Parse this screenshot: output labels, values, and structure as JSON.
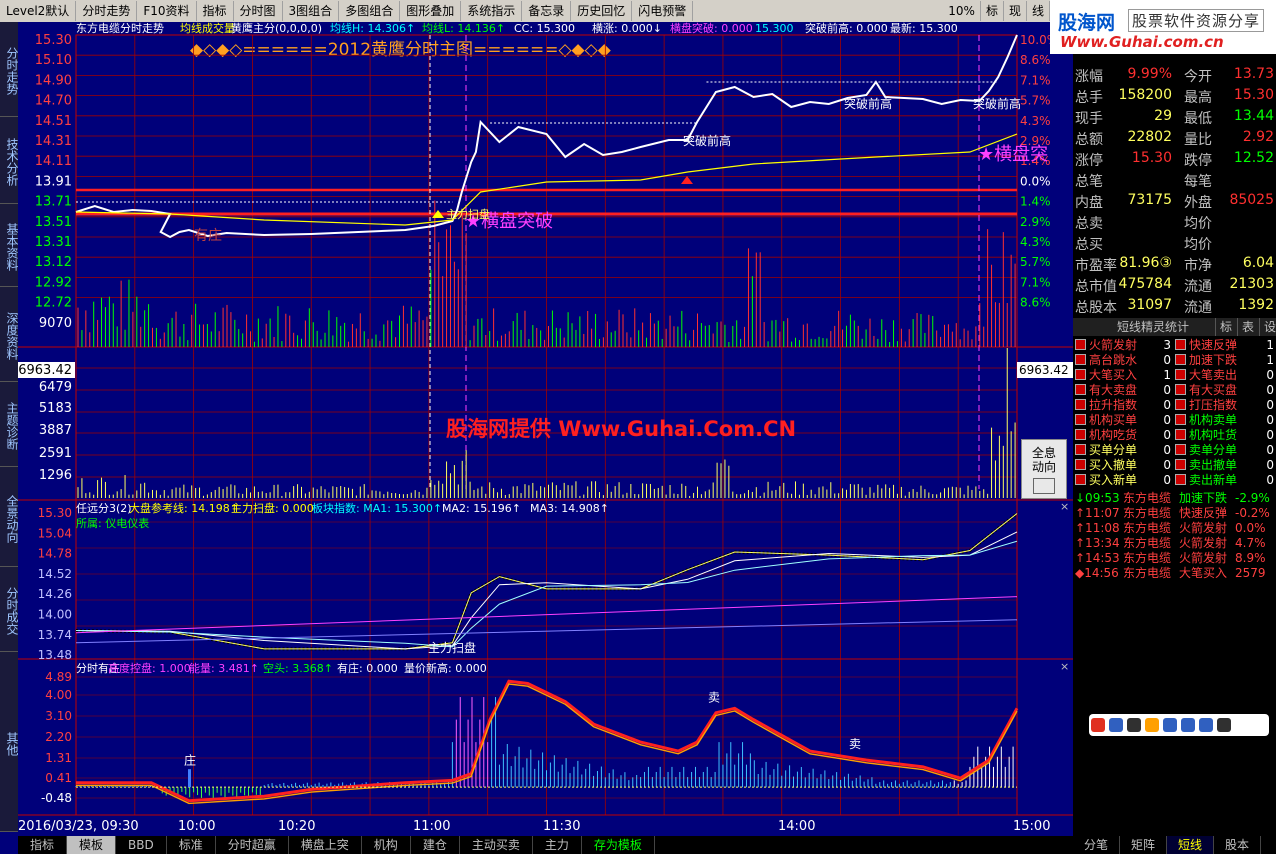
{
  "menubar": {
    "items": [
      "Level2默认",
      "分时走势",
      "F10资料",
      "指标",
      "分时图",
      "3图组合",
      "多图组合",
      "图形叠加",
      "系统指示",
      "备忘录",
      "历史回忆",
      "闪电预警"
    ],
    "right": [
      "10%",
      "标",
      "现",
      "线"
    ]
  },
  "left_tabs": [
    "分时走势",
    "技术分析",
    "基本资料",
    "深度资料",
    "主题诊断",
    "全景动向",
    "分时成交",
    "其他"
  ],
  "main_header": {
    "title": "东方电缆分时走势",
    "items": [
      "均线",
      "成交量",
      "黄鹰主分(0,0,0,0)",
      "均线H: 14.306↑",
      "均线L: 14.136↑",
      "CC: 15.300",
      "横涨: 0.000↓",
      "横盘突破: 0.000",
      "15.300",
      "突破前高: 0.000",
      "最新: 15.300"
    ]
  },
  "banner": "◆◇◆◇======2012黄鹰分时主图======◇◆◇◆",
  "price_axis_left": [
    "15.30",
    "15.10",
    "14.90",
    "14.70",
    "14.51",
    "14.31",
    "14.11",
    "13.91",
    "13.71",
    "13.51",
    "13.31",
    "13.12",
    "12.92",
    "12.72",
    "9070"
  ],
  "pct_axis_right": [
    "10.0%",
    "8.6%",
    "7.1%",
    "5.7%",
    "4.3%",
    "2.9%",
    "1.4%",
    "0.0%",
    "1.4%",
    "2.9%",
    "4.3%",
    "5.7%",
    "7.1%",
    "8.6%"
  ],
  "volume_axis": [
    "6963.42",
    "6479",
    "5183",
    "3887",
    "2591",
    "1296"
  ],
  "volume_right_label": "6963.42",
  "annotations": {
    "tupo1": "突破前高",
    "tupo2": "突破前高",
    "tupo3": "突破前高",
    "hengpan": "横盘突破",
    "hengpan_right": "横盘突",
    "youzhuang": "有庄",
    "zhuli": "主力扫盘",
    "watermark": "股海网提供 Www.Guhai.Com.CN",
    "mai1": "卖",
    "mai2": "卖",
    "zhuang": "庄"
  },
  "panel2": {
    "header": [
      "任远分3(2)",
      "大盘参考线: 14.198↑",
      "主力扫盘: 0.000",
      "板块指数: MA1: 15.300↑",
      "MA2: 15.196↑",
      "MA3: 14.908↑"
    ],
    "sub": "所属: 仪电仪表",
    "axis": [
      "15.30",
      "15.04",
      "14.78",
      "14.52",
      "14.26",
      "14.00",
      "13.74",
      "13.48"
    ]
  },
  "panel3": {
    "header": [
      "分时有庄",
      "高度控盘: 1.000",
      "能量: 3.481↑",
      "空头: 3.368↑",
      "有庄: 0.000",
      "量价新高: 0.000"
    ],
    "axis": [
      "4.89",
      "4.00",
      "3.10",
      "2.20",
      "1.31",
      "0.41",
      "-0.48"
    ]
  },
  "time_axis": [
    "2016/03/23, 09:30",
    "10:00",
    "10:20",
    "11:00",
    "11:30",
    "14:00",
    "15:00"
  ],
  "bottom_tabs": [
    "指标",
    "模板",
    "BBD",
    "标准",
    "分时超赢",
    "横盘上突",
    "机构",
    "建仓",
    "主动买卖",
    "主力",
    "存为模板"
  ],
  "logo": {
    "main": "股海网",
    "sub": "股票软件资源分享",
    "url": "Www.Guhai.com.cn"
  },
  "quote": [
    {
      "l1": "涨幅",
      "v1": "9.99%",
      "l2": "今开",
      "v2": "13.73"
    },
    {
      "l1": "总手",
      "v1": "158200",
      "l2": "最高",
      "v2": "15.30"
    },
    {
      "l1": "现手",
      "v1": "29",
      "l2": "最低",
      "v2": "13.44"
    },
    {
      "l1": "总额",
      "v1": "22802",
      "l2": "量比",
      "v2": "2.92"
    },
    {
      "l1": "涨停",
      "v1": "15.30",
      "l2": "跌停",
      "v2": "12.52"
    },
    {
      "l1": "总笔",
      "v1": "",
      "l2": "每笔",
      "v2": ""
    },
    {
      "l1": "内盘",
      "v1": "73175",
      "l2": "外盘",
      "v2": "85025"
    },
    {
      "l1": "总卖",
      "v1": "",
      "l2": "均价",
      "v2": ""
    },
    {
      "l1": "总买",
      "v1": "",
      "l2": "均价",
      "v2": ""
    },
    {
      "l1": "市盈率",
      "v1": "81.96③",
      "l2": "市净",
      "v2": "6.04"
    },
    {
      "l1": "总市值",
      "v1": "475784",
      "l2": "流通",
      "v2": "21303"
    },
    {
      "l1": "总股本",
      "v1": "31097",
      "l2": "流通",
      "v2": "1392"
    }
  ],
  "sprite": {
    "title": "短线精灵统计",
    "tabs": [
      "标",
      "表",
      "设"
    ]
  },
  "signals": [
    {
      "a": "火箭发射",
      "an": "3",
      "b": "快速反弹",
      "bn": "1"
    },
    {
      "a": "高台跳水",
      "an": "0",
      "b": "加速下跌",
      "bn": "1"
    },
    {
      "a": "大笔买入",
      "an": "1",
      "b": "大笔卖出",
      "bn": "0"
    },
    {
      "a": "有大卖盘",
      "an": "0",
      "b": "有大买盘",
      "bn": "0"
    },
    {
      "a": "拉升指数",
      "an": "0",
      "b": "打压指数",
      "bn": "0"
    },
    {
      "a": "机构买单",
      "an": "0",
      "b": "机构卖单",
      "bn": "0"
    },
    {
      "a": "机构吃货",
      "an": "0",
      "b": "机构吐货",
      "bn": "0"
    },
    {
      "a": "买单分单",
      "an": "0",
      "b": "卖单分单",
      "bn": "0"
    },
    {
      "a": "买入撤单",
      "an": "0",
      "b": "卖出撤单",
      "bn": "0"
    },
    {
      "a": "买入新单",
      "an": "0",
      "b": "卖出新单",
      "bn": "0"
    }
  ],
  "log": [
    {
      "t": "↓09:53",
      "n": "东方电缆",
      "e": "加速下跌",
      "v": "-2.9%"
    },
    {
      "t": "↑11:07",
      "n": "东方电缆",
      "e": "快速反弹",
      "v": "-0.2%"
    },
    {
      "t": "↑11:08",
      "n": "东方电缆",
      "e": "火箭发射",
      "v": "0.0%"
    },
    {
      "t": "↑13:34",
      "n": "东方电缆",
      "e": "火箭发射",
      "v": "4.7%"
    },
    {
      "t": "↑14:53",
      "n": "东方电缆",
      "e": "火箭发射",
      "v": "8.9%"
    },
    {
      "t": "◆14:56",
      "n": "东方电缆",
      "e": "大笔买入",
      "v": "2579"
    }
  ],
  "right_tabs": [
    "分笔",
    "矩阵",
    "短线",
    "股本"
  ],
  "quanxi": "全息动向",
  "colors": {
    "bg": "#00007a",
    "grid": "#a00000",
    "price": "#ffffff",
    "avg": "#ffff00",
    "up": "#ff3030",
    "down": "#00ff00",
    "axis_red": "#ff4040",
    "axis_green": "#00ff00"
  }
}
